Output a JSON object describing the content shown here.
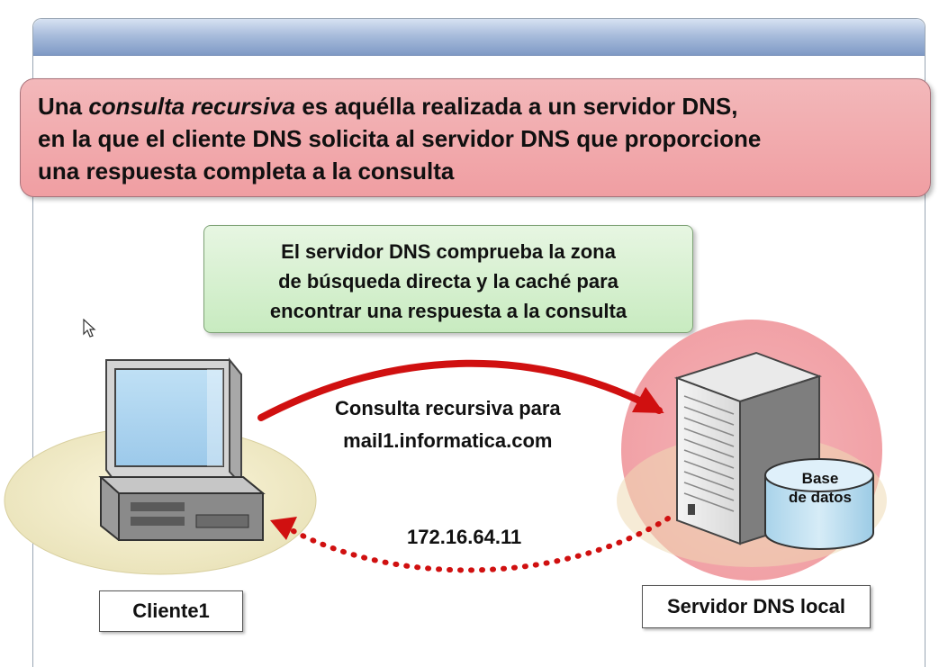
{
  "definition": {
    "line1_before": "Una ",
    "line1_italic": "consulta recursiva",
    "line1_after": " es aquélla realizada a un servidor DNS,",
    "line2": "en la que el cliente DNS solicita al servidor DNS que proporcione",
    "line3": "una respuesta completa a la consulta"
  },
  "note": {
    "line1": "El servidor DNS comprueba la zona",
    "line2": "de búsqueda directa y la caché para",
    "line3": "encontrar una respuesta a la consulta"
  },
  "query_label": {
    "line1": "Consulta recursiva para",
    "line2": "mail1.informatica.com"
  },
  "response_label": "172.16.64.11",
  "database": {
    "line1": "Base",
    "line2": "de datos"
  },
  "client_label": "Cliente1",
  "server_label": "Servidor DNS local",
  "colors": {
    "arrow_red": "#d01010",
    "definition_bg": "#f09ea2",
    "note_bg": "#c8ebc0",
    "header_blue": "#8ea6cf"
  }
}
